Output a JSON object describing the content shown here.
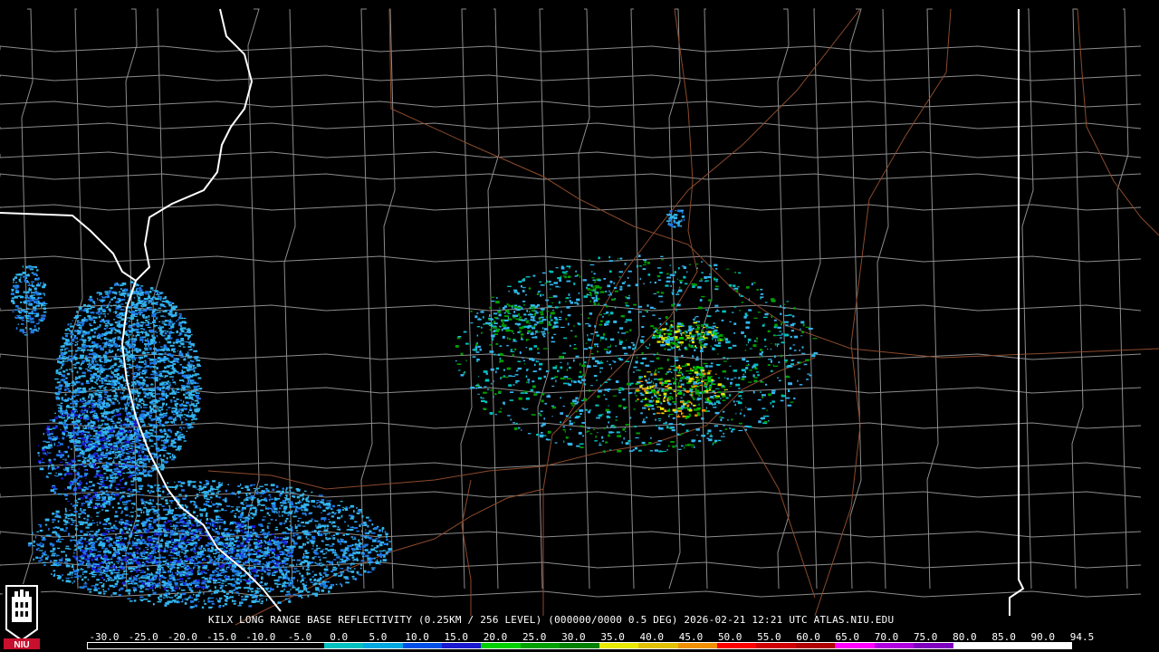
{
  "caption": "KILX LONG RANGE BASE REFLECTIVITY (0.25KM / 256 LEVEL) (000000/0000 0.5 DEG) 2026-02-21 12:21 UTC  ATLAS.NIU.EDU",
  "logo_text": "NIU",
  "scale": {
    "labels": [
      "-30.0",
      "-25.0",
      "-20.0",
      "-15.0",
      "-10.0",
      "-5.0",
      "0.0",
      "5.0",
      "10.0",
      "15.0",
      "20.0",
      "25.0",
      "30.0",
      "35.0",
      "40.0",
      "45.0",
      "50.0",
      "55.0",
      "60.0",
      "65.0",
      "70.0",
      "75.0",
      "80.0",
      "85.0",
      "90.0",
      "94.5"
    ],
    "colors": [
      "#000000",
      "#000000",
      "#000000",
      "#000000",
      "#000000",
      "#000000",
      "#00c0c0",
      "#00a8e0",
      "#0050e8",
      "#1a1ad0",
      "#00d000",
      "#00a000",
      "#008000",
      "#e8e800",
      "#e0c000",
      "#f09000",
      "#ff0000",
      "#d00000",
      "#b00000",
      "#ff00ff",
      "#b000e0",
      "#8000c0",
      "#ffffff",
      "#ffffff",
      "#ffffff"
    ]
  },
  "colors": {
    "county_lines": "#8c8c8c",
    "state_lines": "#ffffff",
    "highways": "#8b4a2b",
    "echo_light": "#33b5ee",
    "echo_mid": "#1e78e6",
    "echo_dark": "#1a1ad0"
  }
}
